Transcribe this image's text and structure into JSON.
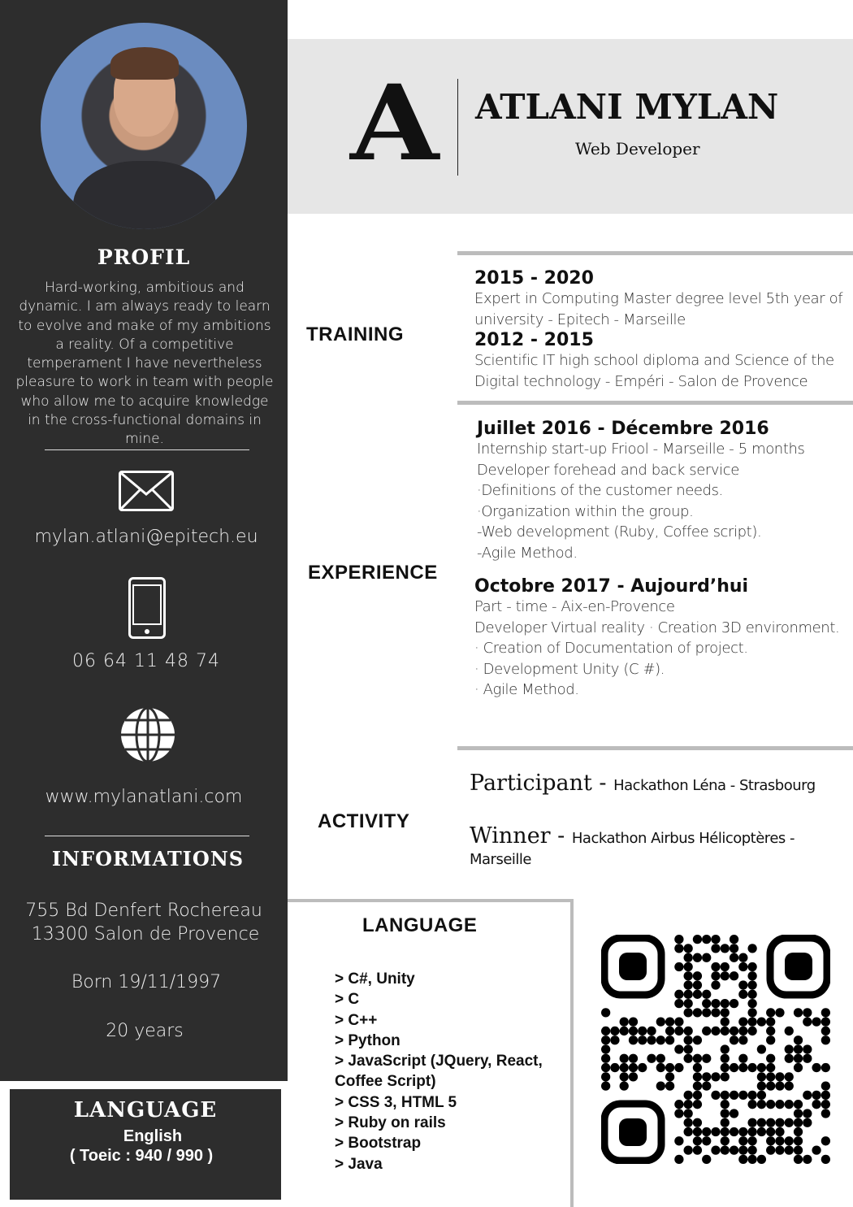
{
  "header": {
    "monogram": "A",
    "name": "ATLANI MYLAN",
    "title": "Web Developer"
  },
  "sidebar": {
    "photo_alt": "Portrait photo",
    "profil_heading": "PROFIL",
    "profil_text": "Hard-working, ambitious and dynamic. I am always ready to learn to evolve and make of my ambitions a reality. Of a competitive temperament I have nevertheless pleasure to work in team with people who allow me to acquire knowledge in the cross-functional domains in mine.",
    "email": "mylan.atlani@epitech.eu",
    "phone": "06 64 11 48 74",
    "website": "www.mylanatlani.com",
    "info_heading": "INFORMATIONS",
    "address_line1": "755 Bd Denfert Rochereau",
    "address_line2": "13300 Salon de Provence",
    "born": "Born 19/11/1997",
    "age": "20 years",
    "language_heading": "LANGUAGE",
    "language": "English",
    "toeic": "( Toeic : 940 / 990 )"
  },
  "training": {
    "heading": "TRAINING",
    "items": [
      {
        "date": "2015 - 2020",
        "lines": [
          "Expert in Computing Master degree level 5th year of",
          "university - Epitech - Marseille"
        ]
      },
      {
        "date": "2012 - 2015",
        "lines": [
          "Scientific IT high school diploma and Science of the",
          "Digital technology - Empéri  - Salon de Provence"
        ]
      }
    ]
  },
  "experience": {
    "heading": "EXPERIENCE",
    "items": [
      {
        "date": "Juillet 2016 - Décembre 2016",
        "lines": [
          "Internship start-up Friool - Marseille - 5 months",
          "Developer forehead and back service",
          "·Definitions of the customer needs.",
          "·Organization within the group.",
          "-Web development (Ruby, Coffee script).",
          "-Agile Method."
        ]
      },
      {
        "date": "Octobre 2017 - Aujourd’hui",
        "lines": [
          "Part - time - Aix-en-Provence",
          "Developer Virtual reality · Creation 3D environment.",
          "· Creation of Documentation of project.",
          "· Development Unity (C #).",
          "· Agile Method."
        ]
      }
    ]
  },
  "activity": {
    "heading": "ACTIVITY",
    "items": [
      {
        "role": "Participant - ",
        "event": "Hackathon Léna - Strasbourg"
      },
      {
        "role": "Winner - ",
        "event": " Hackathon Airbus Hélicoptères - Marseille"
      }
    ]
  },
  "language": {
    "heading": "LANGUAGE",
    "skills": [
      "> C#, Unity",
      "> C",
      "> C++",
      "> Python",
      "> JavaScript (JQuery, React, Coffee Script)",
      "> CSS 3, HTML 5",
      "> Ruby on rails",
      "> Bootstrap",
      "> Java"
    ]
  },
  "colors": {
    "sidebar": "#2d2d2d",
    "band": "#e6e6e6",
    "rule": "#bcbcbc"
  }
}
